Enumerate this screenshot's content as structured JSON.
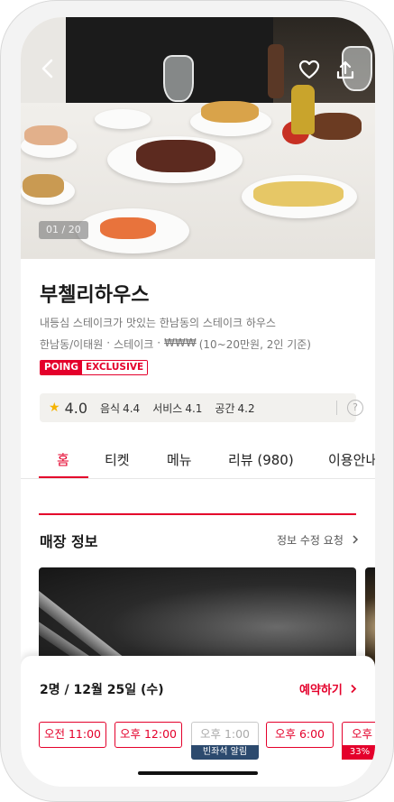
{
  "hero": {
    "counter": "01 / 20"
  },
  "restaurant": {
    "name": "부첼리하우스",
    "description": "내등심 스테이크가 맛있는 한남동의 스테이크 하우스",
    "location": "한남동/이태원",
    "cuisine": "스테이크",
    "price_symbol": "₩₩₩",
    "price_range": "(10~20만원, 2인 기준)",
    "dot": "·",
    "badge_left": "POING",
    "badge_right": "EXCLUSIVE"
  },
  "rating": {
    "overall": "4.0",
    "food_label": "음식",
    "food_value": "4.4",
    "service_label": "서비스",
    "service_value": "4.1",
    "space_label": "공간",
    "space_value": "4.2",
    "help_icon": "?"
  },
  "tabs": [
    "홈",
    "티켓",
    "메뉴",
    "리뷰 (980)",
    "이용안내"
  ],
  "section": {
    "title": "매장 정보",
    "edit_link": "정보 수정 요청"
  },
  "booking": {
    "summary": "2명 / 12월 25일 (수)",
    "reserve_label": "예약하기",
    "slots": [
      "오전 11:00",
      "오후 12:00",
      "오후 1:00",
      "오후 6:00",
      "오후"
    ],
    "waitlist_tag": "빈좌석 알림",
    "discount_tag": "33%"
  },
  "colors": {
    "accent": "#e4002b",
    "tag_navy": "#2c4a6e",
    "star": "#f5b301"
  }
}
